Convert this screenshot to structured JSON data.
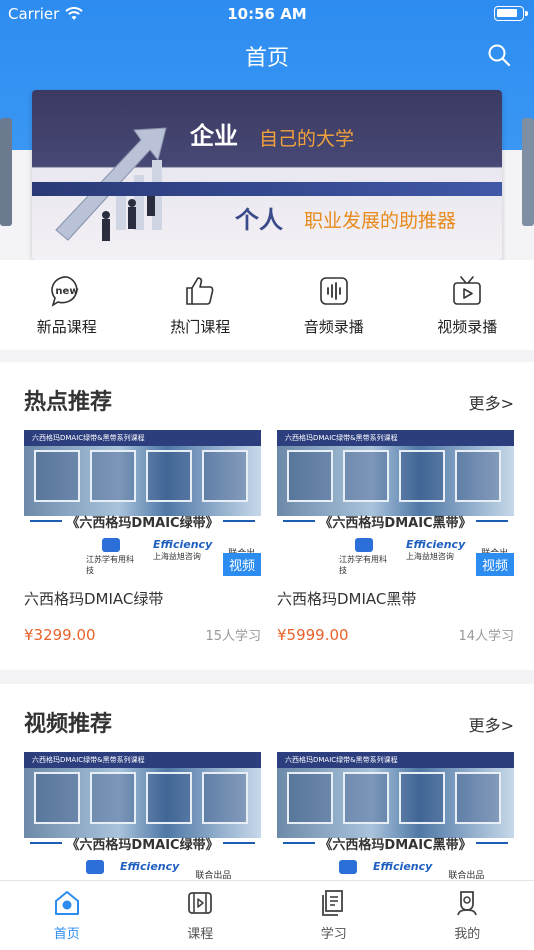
{
  "status_bar": {
    "carrier": "Carrier",
    "time": "10:56 AM"
  },
  "header": {
    "title": "首页"
  },
  "banner": {
    "line1_main": "企业",
    "line1_sub": "自己的大学",
    "line2_main": "个人",
    "line2_sub": "职业发展的助推器"
  },
  "categories": [
    {
      "label": "新品课程",
      "icon": "new-icon"
    },
    {
      "label": "热门课程",
      "icon": "thumbs-up-icon"
    },
    {
      "label": "音频录播",
      "icon": "audio-icon"
    },
    {
      "label": "视频录播",
      "icon": "tv-icon"
    }
  ],
  "hot": {
    "title": "热点推荐",
    "more": "更多>",
    "cards": [
      {
        "thumb_header": "六西格玛DMAIC绿带&黑带系列课程",
        "thumb_title": "《六西格玛DMAIC绿带》",
        "logo1": "江苏学有用科技",
        "logo2": "Efficiency",
        "logo2_sub": "上海益旭咨询",
        "co": "联合出品",
        "tag": "视频",
        "name": "六西格玛DMIAC绿带",
        "price": "¥3299.00",
        "learners": "15人学习"
      },
      {
        "thumb_header": "六西格玛DMAIC绿带&黑带系列课程",
        "thumb_title": "《六西格玛DMAIC黑带》",
        "logo1": "江苏学有用科技",
        "logo2": "Efficiency",
        "logo2_sub": "上海益旭咨询",
        "co": "联合出品",
        "tag": "视频",
        "name": "六西格玛DMIAC黑带",
        "price": "¥5999.00",
        "learners": "14人学习"
      }
    ]
  },
  "video": {
    "title": "视频推荐",
    "more": "更多>",
    "cards": [
      {
        "thumb_header": "六西格玛DMAIC绿带&黑带系列课程",
        "thumb_title": "《六西格玛DMAIC绿带》",
        "logo2": "Efficiency",
        "co": "联合出品"
      },
      {
        "thumb_header": "六西格玛DMAIC绿带&黑带系列课程",
        "thumb_title": "《六西格玛DMAIC黑带》",
        "logo2": "Efficiency",
        "co": "联合出品"
      }
    ]
  },
  "tabs": [
    {
      "label": "首页",
      "icon": "home-icon",
      "active": true
    },
    {
      "label": "课程",
      "icon": "course-icon",
      "active": false
    },
    {
      "label": "学习",
      "icon": "study-icon",
      "active": false
    },
    {
      "label": "我的",
      "icon": "profile-icon",
      "active": false
    }
  ],
  "colors": {
    "primary": "#2d8cf0",
    "price": "#e8632b",
    "muted": "#999999"
  }
}
